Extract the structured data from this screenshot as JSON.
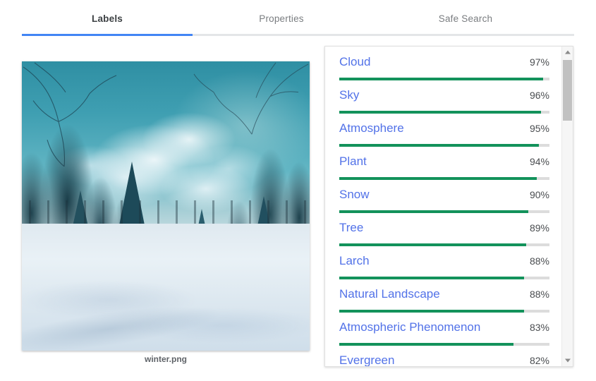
{
  "tabs": [
    {
      "label": "Labels",
      "active": true
    },
    {
      "label": "Properties",
      "active": false
    },
    {
      "label": "Safe Search",
      "active": false
    }
  ],
  "preview": {
    "caption": "winter.png",
    "alt": "Winter forest painting with snow covered evergreen trees under a blue sky with clouds"
  },
  "colors": {
    "accent_blue": "#4285f4",
    "label_blue": "#5272e8",
    "bar_green": "#13925b",
    "bar_track": "#dcdcdc",
    "tab_active_text": "#3c4043",
    "tab_inactive_text": "#7a7d80"
  },
  "labels": [
    {
      "name": "Cloud",
      "score": 97,
      "percent": "97%"
    },
    {
      "name": "Sky",
      "score": 96,
      "percent": "96%"
    },
    {
      "name": "Atmosphere",
      "score": 95,
      "percent": "95%"
    },
    {
      "name": "Plant",
      "score": 94,
      "percent": "94%"
    },
    {
      "name": "Snow",
      "score": 90,
      "percent": "90%"
    },
    {
      "name": "Tree",
      "score": 89,
      "percent": "89%"
    },
    {
      "name": "Larch",
      "score": 88,
      "percent": "88%"
    },
    {
      "name": "Natural Landscape",
      "score": 88,
      "percent": "88%"
    },
    {
      "name": "Atmospheric Phenomenon",
      "score": 83,
      "percent": "83%"
    },
    {
      "name": "Evergreen",
      "score": 82,
      "percent": "82%"
    }
  ],
  "scrollbar": {
    "up_arrow": "scroll-up-arrow",
    "down_arrow": "scroll-down-arrow",
    "thumb": "scroll-thumb"
  }
}
